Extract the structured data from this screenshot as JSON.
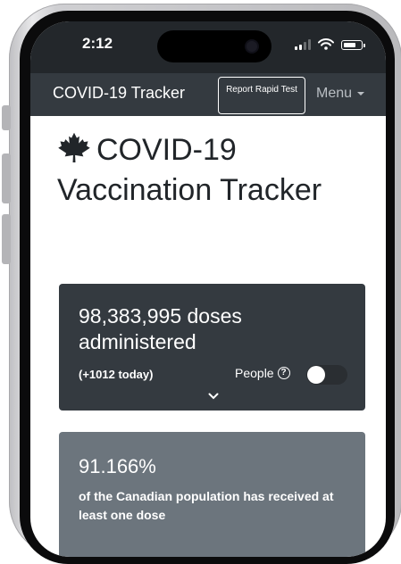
{
  "status_bar": {
    "time": "2:12"
  },
  "navbar": {
    "brand": "COVID-19 Tracker",
    "report_button": "Report Rapid Test",
    "menu_label": "Menu"
  },
  "page": {
    "title": "COVID-19 Vaccination Tracker"
  },
  "doses_card": {
    "doses_text": "98,383,995 doses administered",
    "today_text": "(+1012 today)",
    "toggle_label": "People",
    "toggle_on": false
  },
  "population_card": {
    "percent": "91.166%",
    "description": "of the Canadian population has received at least one dose"
  },
  "colors": {
    "navbar": "#343a40",
    "doses_card": "#343a40",
    "population_card": "#6c757d"
  }
}
